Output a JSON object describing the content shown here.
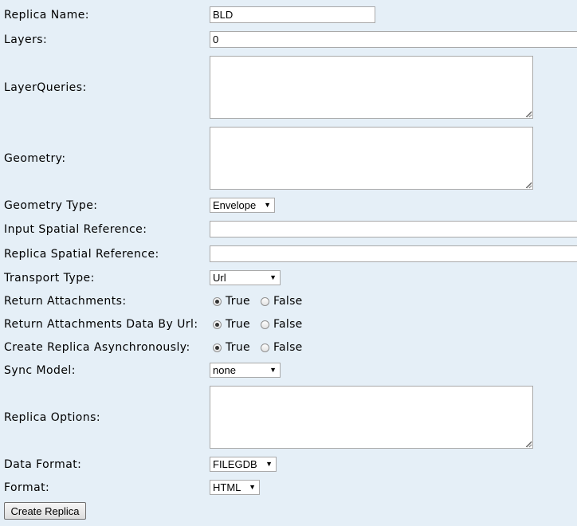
{
  "form": {
    "replica_name": {
      "label": "Replica Name:",
      "value": "BLD"
    },
    "layers": {
      "label": "Layers:",
      "value": "0"
    },
    "layer_queries": {
      "label": "LayerQueries:",
      "value": ""
    },
    "geometry": {
      "label": "Geometry:",
      "value": ""
    },
    "geometry_type": {
      "label": "Geometry Type:",
      "selected": "Envelope"
    },
    "input_spatial_reference": {
      "label": "Input Spatial Reference:",
      "value": ""
    },
    "replica_spatial_reference": {
      "label": "Replica Spatial Reference:",
      "value": ""
    },
    "transport_type": {
      "label": "Transport Type:",
      "selected": "Url"
    },
    "return_attachments": {
      "label": "Return Attachments:",
      "selected": "True"
    },
    "return_attachments_data_by_url": {
      "label": "Return Attachments Data By Url:",
      "selected": "True"
    },
    "create_replica_async": {
      "label": "Create Replica Asynchronously:",
      "selected": "True"
    },
    "sync_model": {
      "label": "Sync Model:",
      "selected": "none"
    },
    "replica_options": {
      "label": "Replica Options:",
      "value": ""
    },
    "data_format": {
      "label": "Data Format:",
      "selected": "FILEGDB"
    },
    "format": {
      "label": "Format:",
      "selected": "HTML"
    }
  },
  "radio_options": {
    "true_label": "True",
    "false_label": "False"
  },
  "submit": {
    "label": "Create Replica"
  },
  "icons": {
    "dropdown": "caret-down-icon",
    "resize": "resize-grip-icon"
  }
}
